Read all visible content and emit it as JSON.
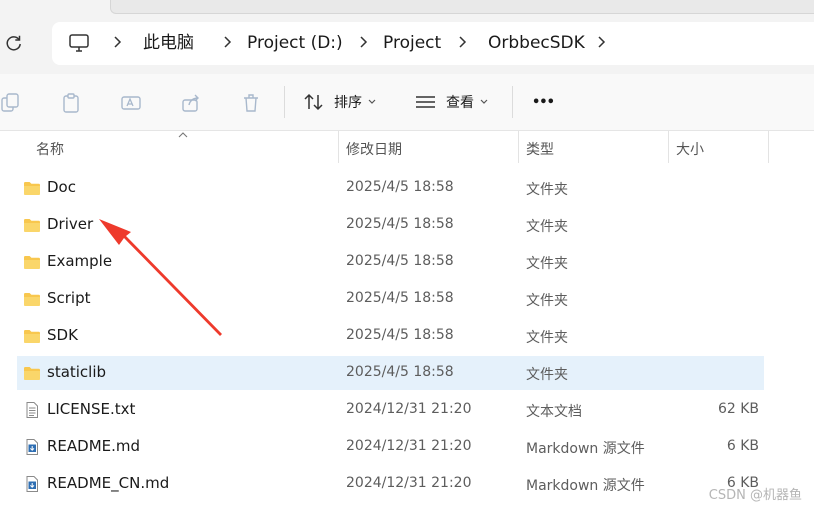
{
  "breadcrumb": [
    "此电脑",
    "Project (D:)",
    "Project",
    "OrbbecSDK"
  ],
  "toolbar": {
    "sort_label": "排序",
    "view_label": "查看",
    "more_label": "•••"
  },
  "columns": {
    "name": "名称",
    "modified": "修改日期",
    "type": "类型",
    "size": "大小"
  },
  "files": [
    {
      "name": "Doc",
      "modified": "2025/4/5 18:58",
      "type": "文件夹",
      "size": "",
      "icon": "folder-icon",
      "selected": false
    },
    {
      "name": "Driver",
      "modified": "2025/4/5 18:58",
      "type": "文件夹",
      "size": "",
      "icon": "folder-icon",
      "selected": false
    },
    {
      "name": "Example",
      "modified": "2025/4/5 18:58",
      "type": "文件夹",
      "size": "",
      "icon": "folder-icon",
      "selected": false
    },
    {
      "name": "Script",
      "modified": "2025/4/5 18:58",
      "type": "文件夹",
      "size": "",
      "icon": "folder-icon",
      "selected": false
    },
    {
      "name": "SDK",
      "modified": "2025/4/5 18:58",
      "type": "文件夹",
      "size": "",
      "icon": "folder-icon",
      "selected": false
    },
    {
      "name": "staticlib",
      "modified": "2025/4/5 18:58",
      "type": "文件夹",
      "size": "",
      "icon": "folder-icon",
      "selected": true
    },
    {
      "name": "LICENSE.txt",
      "modified": "2024/12/31 21:20",
      "type": "文本文档",
      "size": "62 KB",
      "icon": "text-file-icon",
      "selected": false
    },
    {
      "name": "README.md",
      "modified": "2024/12/31 21:20",
      "type": "Markdown 源文件",
      "size": "6 KB",
      "icon": "markdown-file-icon",
      "selected": false
    },
    {
      "name": "README_CN.md",
      "modified": "2024/12/31 21:20",
      "type": "Markdown 源文件",
      "size": "6 KB",
      "icon": "markdown-file-icon",
      "selected": false
    }
  ],
  "watermark": "CSDN @机器鱼",
  "colors": {
    "selection": "#e5f1fb",
    "folder": "#f8c74e",
    "annotation_arrow": "#ee3a2c"
  }
}
